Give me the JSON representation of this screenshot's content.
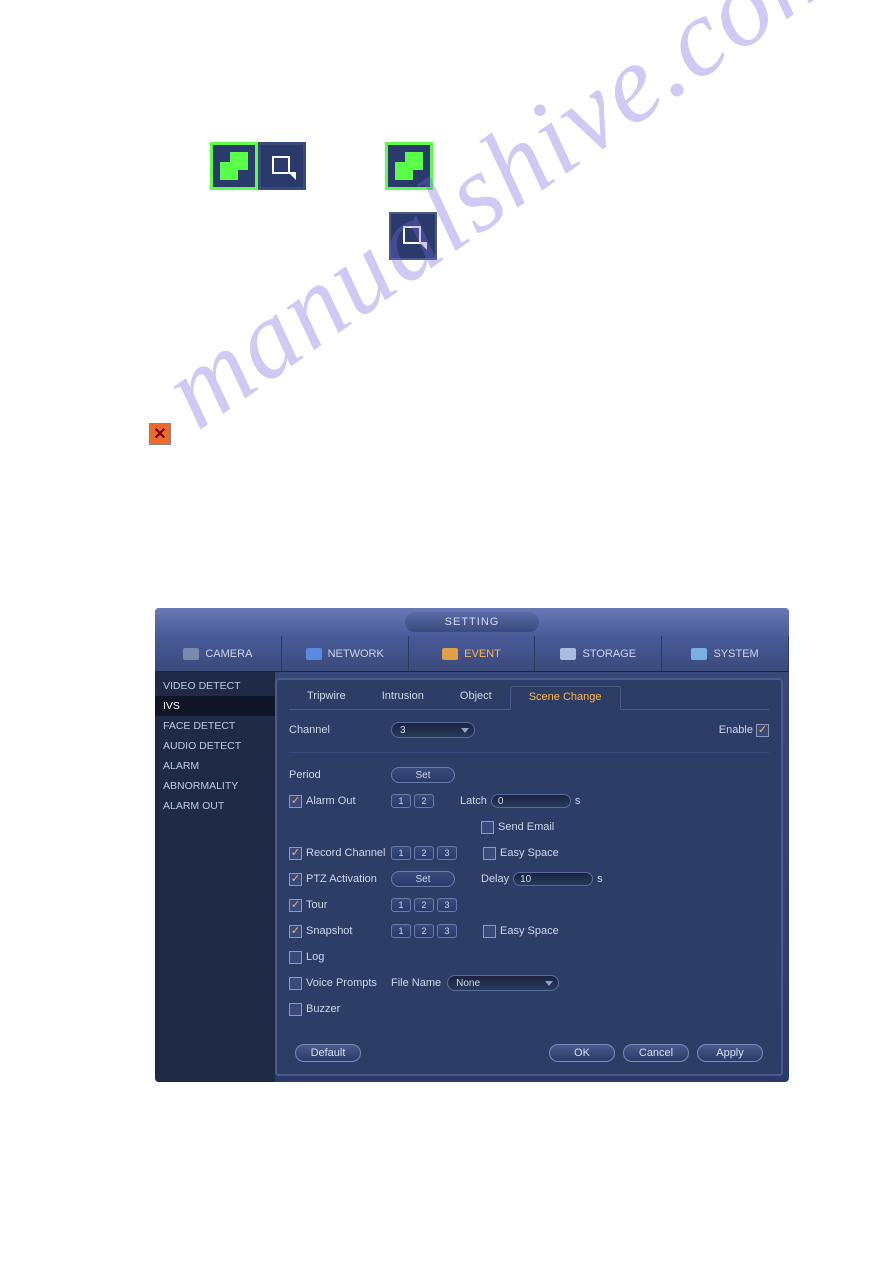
{
  "watermark": "manualshive.com",
  "settings": {
    "title": "SETTING",
    "topnav": [
      {
        "label": "CAMERA"
      },
      {
        "label": "NETWORK"
      },
      {
        "label": "EVENT",
        "active": true
      },
      {
        "label": "STORAGE"
      },
      {
        "label": "SYSTEM"
      }
    ],
    "sidebar": [
      {
        "label": "VIDEO DETECT"
      },
      {
        "label": "IVS",
        "active": true
      },
      {
        "label": "FACE DETECT"
      },
      {
        "label": "AUDIO DETECT"
      },
      {
        "label": "ALARM"
      },
      {
        "label": "ABNORMALITY"
      },
      {
        "label": "ALARM OUT"
      }
    ],
    "tabs": [
      {
        "label": "Tripwire"
      },
      {
        "label": "Intrusion"
      },
      {
        "label": "Object"
      },
      {
        "label": "Scene Change",
        "active": true
      }
    ],
    "fields": {
      "channel_label": "Channel",
      "channel_value": "3",
      "enable_label": "Enable",
      "enable_checked": true,
      "period_label": "Period",
      "period_set": "Set",
      "alarm_out_label": "Alarm Out",
      "alarm_out_checked": true,
      "alarm_out_buttons": [
        "1",
        "2"
      ],
      "latch_label": "Latch",
      "latch_value": "0",
      "latch_unit": "s",
      "send_email_label": "Send Email",
      "send_email_checked": false,
      "record_channel_label": "Record Channel",
      "record_channel_checked": true,
      "record_channel_buttons": [
        "1",
        "2",
        "3"
      ],
      "easy_space1_label": "Easy Space",
      "easy_space1_checked": false,
      "ptz_label": "PTZ Activation",
      "ptz_checked": true,
      "ptz_set": "Set",
      "delay_label": "Delay",
      "delay_value": "10",
      "delay_unit": "s",
      "tour_label": "Tour",
      "tour_checked": true,
      "tour_buttons": [
        "1",
        "2",
        "3"
      ],
      "snapshot_label": "Snapshot",
      "snapshot_checked": true,
      "snapshot_buttons": [
        "1",
        "2",
        "3"
      ],
      "easy_space2_label": "Easy Space",
      "easy_space2_checked": false,
      "log_label": "Log",
      "log_checked": false,
      "voice_label": "Voice Prompts",
      "voice_checked": false,
      "filename_label": "File Name",
      "filename_value": "None",
      "buzzer_label": "Buzzer",
      "buzzer_checked": false
    },
    "footer": {
      "default": "Default",
      "ok": "OK",
      "cancel": "Cancel",
      "apply": "Apply"
    }
  }
}
